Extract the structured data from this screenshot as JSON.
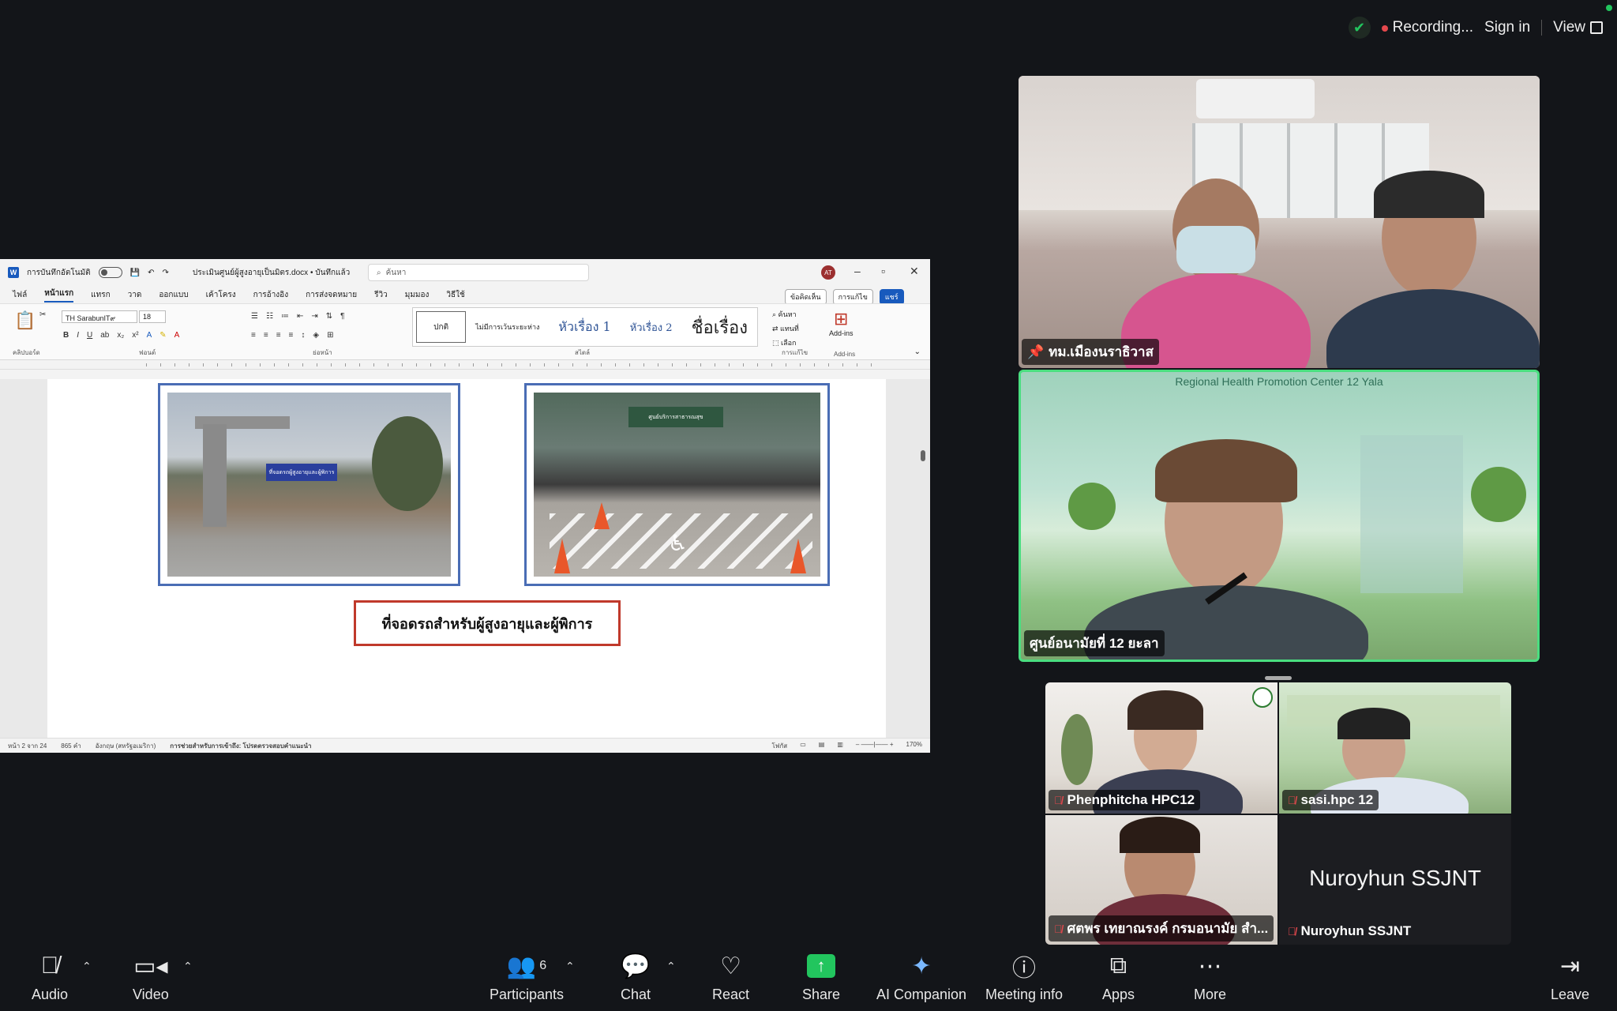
{
  "topbar": {
    "recording": "Recording...",
    "sign_in": "Sign in",
    "view": "View"
  },
  "word": {
    "autosave_label": "การบันทึกอัตโนมัติ",
    "doc_title": "ประเมินศูนย์ผู้สูงอายุเป็นมิตร.docx • บันทึกแล้ว",
    "search_placeholder": "ค้นหา",
    "avatar": "AT",
    "menu": [
      "ไฟล์",
      "หน้าแรก",
      "แทรก",
      "วาด",
      "ออกแบบ",
      "เค้าโครง",
      "การอ้างอิง",
      "การส่งจดหมาย",
      "รีวิว",
      "มุมมอง",
      "วิธีใช้"
    ],
    "comments_btn": "ข้อคิดเห็น",
    "editing_btn": "การแก้ไข",
    "share_btn": "แชร์",
    "font_name": "TH SarabunIT๙",
    "font_size": "18",
    "styles": {
      "normal": "ปกติ",
      "no_spacing": "ไม่มีการเว้นระยะห่าง",
      "heading1": "หัวเรื่อง 1",
      "heading2": "หัวเรื่อง 2",
      "title": "ชื่อเรื่อง"
    },
    "ribbon_groups": {
      "clipboard": "คลิปบอร์ด",
      "font": "ฟอนต์",
      "paragraph": "ย่อหน้า",
      "styles": "สไตล์",
      "editing": "การแก้ไข",
      "addins": "Add-ins"
    },
    "editing_items": [
      "ค้นหา",
      "แทนที่",
      "เลือก"
    ],
    "addins_label": "Add-ins",
    "photo1_sign": "ที่จอดรถผู้สูงอายุและผู้พิการ",
    "photo2_sign": "ศูนย์บริการสาธารณสุข",
    "caption": "ที่จอดรถสำหรับผู้สูงอายุและผู้พิการ",
    "status": {
      "page": "หน้า 2 จาก 24",
      "words": "865 คำ",
      "language": "อังกฤษ (สหรัฐอเมริกา)",
      "accessibility": "การช่วยสำหรับการเข้าถึง: โปรดตรวจสอบคำแนะนำ",
      "focus": "โฟกัส",
      "zoom": "170%"
    }
  },
  "tiles": [
    {
      "name": "ทม.เมืองนราธิวาส",
      "pinned": true
    },
    {
      "name": "ศูนย์อนามัยที่ 12 ยะลา",
      "banner": "Regional Health Promotion Center 12 Yala"
    },
    {
      "name": "Phenphitcha HPC12",
      "muted": true
    },
    {
      "name": "sasi.hpc 12",
      "muted": true
    },
    {
      "name": "ศตพร เทยาณรงค์ กรมอนามัย สำ...",
      "muted": true
    },
    {
      "name": "Nuroyhun SSJNT",
      "muted": true,
      "video_off": true
    }
  ],
  "toolbar": {
    "audio": "Audio",
    "video": "Video",
    "participants": "Participants",
    "participants_count": "6",
    "chat": "Chat",
    "react": "React",
    "share": "Share",
    "ai_companion": "AI Companion",
    "meeting_info": "Meeting info",
    "apps": "Apps",
    "more": "More",
    "leave": "Leave"
  }
}
